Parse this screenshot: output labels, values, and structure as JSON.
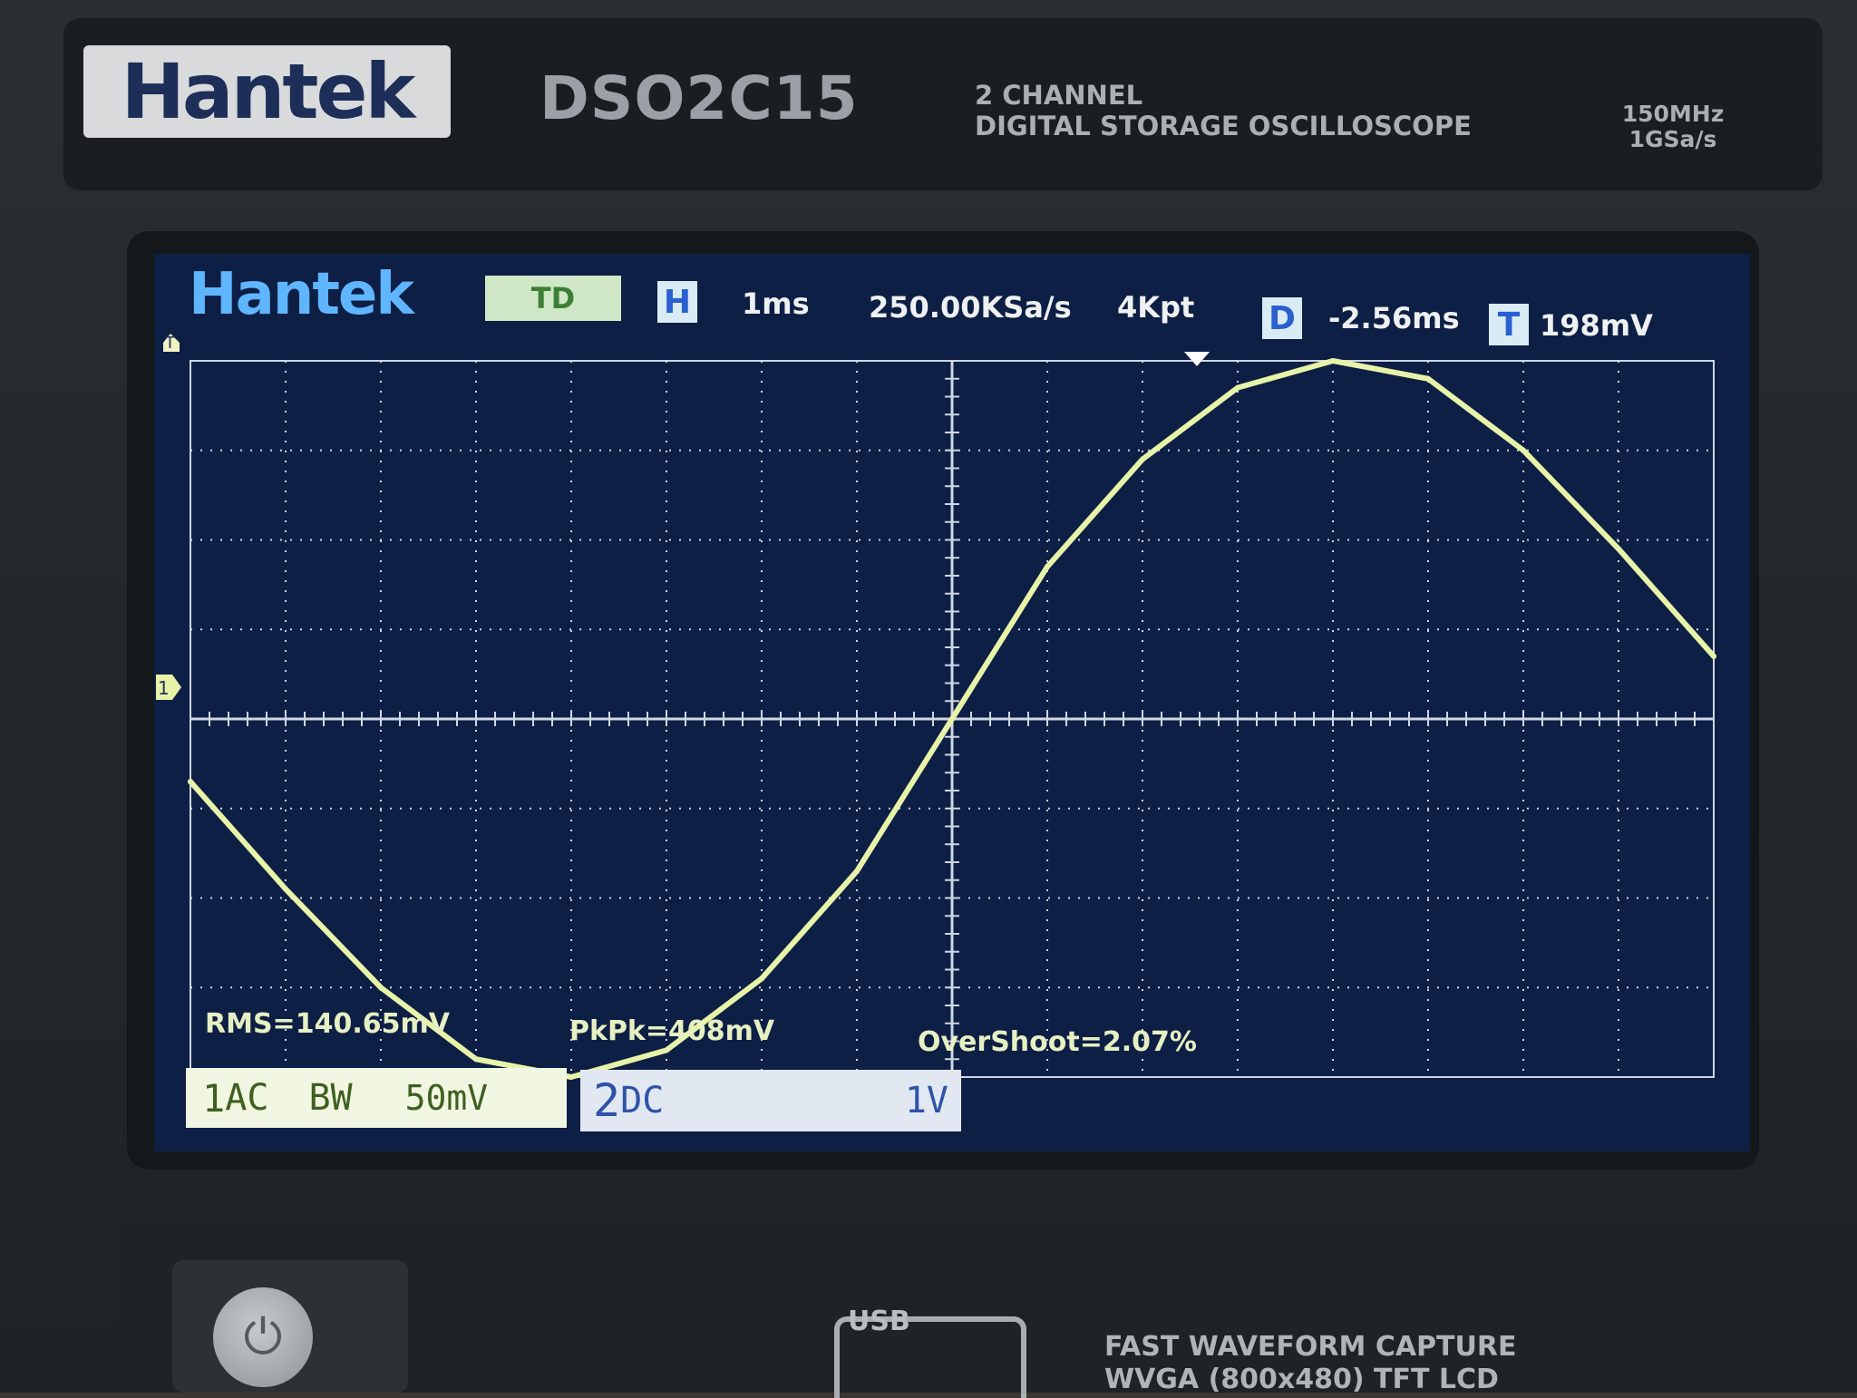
{
  "device": {
    "brand": "Hantek",
    "model": "DSO2C15",
    "description_line1": "2 CHANNEL",
    "description_line2": "DIGITAL STORAGE OSCILLOSCOPE",
    "spec_line1": "150MHz",
    "spec_line2": "1GSa/s",
    "usb_label": "USB",
    "footer_line1": "FAST WAVEFORM CAPTURE",
    "footer_line2": "WVGA (800x480) TFT LCD",
    "power_icon": "power-icon"
  },
  "screen": {
    "logo": "Hantek",
    "mode": "TD",
    "h_tag": "H",
    "timebase": "1ms",
    "sample_rate": "250.00KSa/s",
    "memory_depth": "4Kpt",
    "d_tag": "D",
    "delay": "-2.56ms",
    "t_tag": "T",
    "trigger_level": "198mV",
    "trigger_marker": "T",
    "channel_marker": "1",
    "measurements": {
      "rms": "RMS=140.65mV",
      "pkpk": "PkPk=408mV",
      "overshoot": "OverShoot=2.07%"
    },
    "ch1": {
      "number": "1",
      "coupling": "AC",
      "bw": "BW",
      "scale": "50mV"
    },
    "ch2": {
      "number": "2",
      "coupling": "DC",
      "scale": "1V"
    },
    "colors": {
      "trace": "#e7f3a8",
      "background": "#0e1f45",
      "grid": "#cfd6e4"
    }
  },
  "chart_data": {
    "type": "line",
    "title": "",
    "xlabel": "",
    "ylabel": "",
    "x_unit": "div",
    "y_unit": "div",
    "xlim": [
      -8,
      8
    ],
    "ylim": [
      -4,
      4
    ],
    "grid": true,
    "series": [
      {
        "x": [
          -8.0,
          -7.0,
          -6.0,
          -5.0,
          -4.0,
          -3.0,
          -2.0,
          -1.0,
          0.0,
          1.0,
          2.0,
          3.0,
          4.0,
          5.0,
          6.0,
          7.0,
          8.0
        ],
        "y": [
          -0.7,
          -1.9,
          -3.0,
          -3.8,
          -4.0,
          -3.7,
          -2.9,
          -1.7,
          0.0,
          1.7,
          2.9,
          3.7,
          4.0,
          3.8,
          3.0,
          1.9,
          0.7
        ]
      }
    ]
  }
}
